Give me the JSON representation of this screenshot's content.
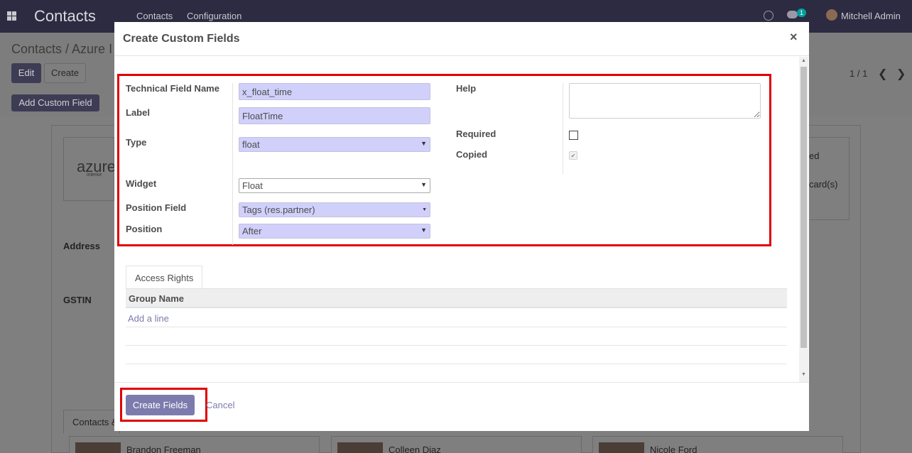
{
  "topbar": {
    "app_title": "Contacts",
    "menu": [
      "Contacts",
      "Configuration"
    ],
    "chat_badge": "1",
    "user_name": "Mitchell Admin"
  },
  "control_panel": {
    "breadcrumb": "Contacts / Azure I",
    "edit_label": "Edit",
    "create_label": "Create",
    "pager": "1 / 1",
    "add_custom_field_label": "Add Custom Field"
  },
  "background": {
    "logo_text": "azure",
    "logo_sub": "interior",
    "address_label": "Address",
    "gstin_label": "GSTIN",
    "stat_1": "ed",
    "stat_2": "card(s)",
    "tab_label": "Contacts &",
    "contacts": [
      "Brandon Freeman",
      "Colleen Diaz",
      "Nicole Ford"
    ]
  },
  "modal": {
    "title": "Create Custom Fields",
    "close_glyph": "×",
    "form": {
      "technical_name_label": "Technical Field Name",
      "technical_name_value": "x_float_time",
      "label_label": "Label",
      "label_value": "FloatTime",
      "type_label": "Type",
      "type_value": "float",
      "widget_label": "Widget",
      "widget_value": "Float",
      "position_field_label": "Position Field",
      "position_field_value": "Tags (res.partner)",
      "position_label": "Position",
      "position_value": "After",
      "help_label": "Help",
      "help_value": "",
      "required_label": "Required",
      "required_checked": false,
      "copied_label": "Copied",
      "copied_checked": true
    },
    "tabs": [
      "Access Rights"
    ],
    "table": {
      "column": "Group Name",
      "add_line": "Add a line"
    },
    "footer": {
      "create_label": "Create Fields",
      "cancel_label": "Cancel"
    },
    "highlight_color": "#e00000"
  }
}
